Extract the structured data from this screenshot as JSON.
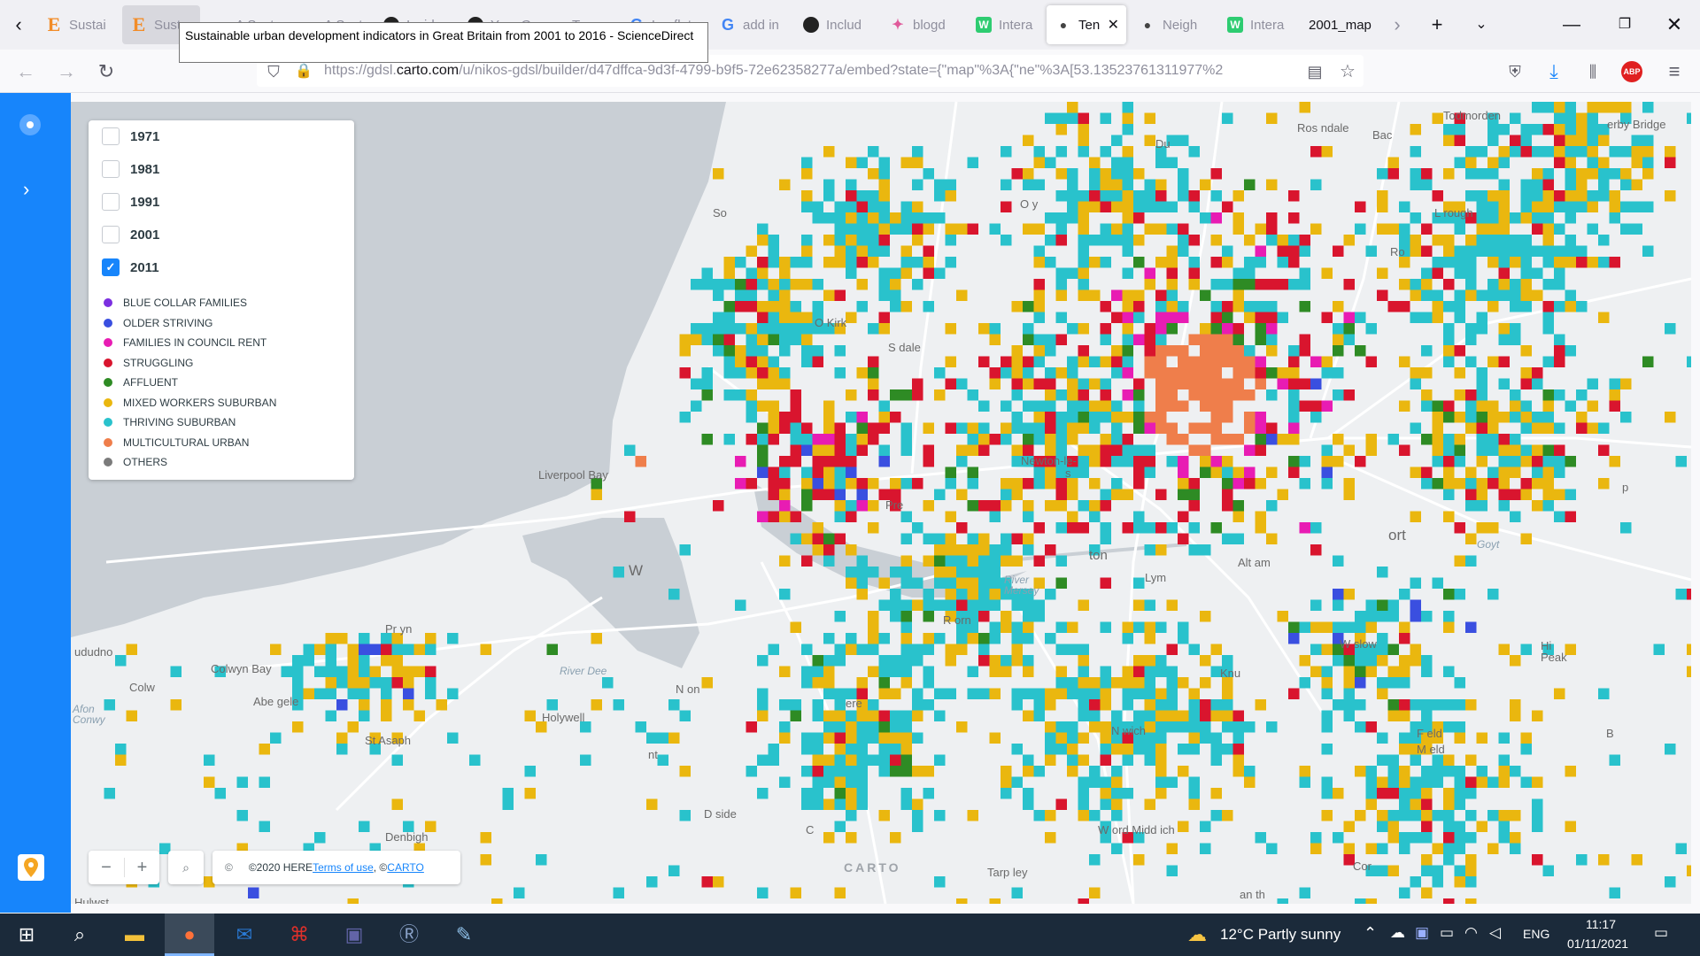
{
  "tabs": [
    {
      "label": "Sustai",
      "favicon": "e-icon",
      "state": "inactive"
    },
    {
      "label": "Susta",
      "favicon": "e-icon",
      "state": "hovered"
    },
    {
      "label": "A Sust",
      "favicon": "doc-icon",
      "state": "inactive"
    },
    {
      "label": "A Sust",
      "favicon": "doc-icon",
      "state": "inactive"
    },
    {
      "label": "Inside",
      "favicon": "github-icon",
      "state": "inactive"
    },
    {
      "label": "Your G",
      "favicon": "github-icon",
      "state": "inactive"
    },
    {
      "label": "Ten",
      "favicon": "dot-icon",
      "state": "inactive"
    },
    {
      "label": "Leaflet",
      "favicon": "g-icon",
      "state": "inactive"
    },
    {
      "label": "add in",
      "favicon": "google-icon",
      "state": "inactive"
    },
    {
      "label": "Includ",
      "favicon": "github-icon",
      "state": "inactive"
    },
    {
      "label": "blogd",
      "favicon": "blog-icon",
      "state": "inactive"
    },
    {
      "label": "Intera",
      "favicon": "w-icon",
      "state": "inactive"
    },
    {
      "label": "Ten",
      "favicon": "dot-icon",
      "state": "active"
    },
    {
      "label": "Neigh",
      "favicon": "dot-icon",
      "state": "inactive"
    },
    {
      "label": "Intera",
      "favicon": "w-icon",
      "state": "inactive"
    },
    {
      "label": "2001_map",
      "favicon": "",
      "state": "plain"
    }
  ],
  "tooltip": "Sustainable urban development indicators in Great Britain from 2001 to 2016 - ScienceDirect",
  "url": {
    "prefix": "https://gdsl.",
    "domain": "carto.com",
    "rest": "/u/nikos-gdsl/builder/d47dffca-9d3f-4799-b9f5-72e62358277a/embed?state={\"map\"%3A{\"ne\"%3A[53.13523761311977%2"
  },
  "legend": {
    "years": [
      {
        "label": "1971",
        "checked": false
      },
      {
        "label": "1981",
        "checked": false
      },
      {
        "label": "1991",
        "checked": false
      },
      {
        "label": "2001",
        "checked": false
      },
      {
        "label": "2011",
        "checked": true
      }
    ],
    "categories": [
      {
        "label": "BLUE COLLAR FAMILIES",
        "color": "#7b2fe0"
      },
      {
        "label": "OLDER STRIVING",
        "color": "#3a4fe0"
      },
      {
        "label": "FAMILIES IN COUNCIL RENT",
        "color": "#e81cb3"
      },
      {
        "label": "STRUGGLING",
        "color": "#d9152e"
      },
      {
        "label": "AFFLUENT",
        "color": "#2e8b24"
      },
      {
        "label": "MIXED WORKERS SUBURBAN",
        "color": "#eab70f"
      },
      {
        "label": "THRIVING SUBURBAN",
        "color": "#29c2cc"
      },
      {
        "label": "MULTICULTURAL URBAN",
        "color": "#ef7e4b"
      },
      {
        "label": "OTHERS",
        "color": "#7b7b7b"
      }
    ]
  },
  "map": {
    "places": [
      "Todmorden",
      "Ros  ndale",
      "Bac",
      "erby Bridge",
      "Du",
      "O   y",
      "L    rough",
      "Ro",
      "So",
      "O   Kirk",
      "S      dale",
      "Newton-le-",
      "s",
      "Liverpool Bay",
      "Pre",
      "W",
      "Alt      am",
      "ort",
      "p",
      "Goyt",
      "ton",
      "Lym",
      "R     orn",
      "W       slow",
      "Hi Peak",
      "Knu",
      "Pr    yn",
      "Colwyn Bay",
      "Colw",
      "Abe   gele",
      "St Asaph",
      "Holywell",
      "N   on",
      "ere",
      "N    wich",
      "F    eld",
      "B",
      "M   eld",
      "D   side",
      "C",
      "Denbigh",
      "W         ord  Midd     ich",
      "Tarp   ley",
      "Cor",
      "an     th",
      "nt",
      "Hulwst",
      "ududno"
    ],
    "waters": [
      "River Dee",
      "River Mersey",
      "Afon Conwy"
    ]
  },
  "attribution": {
    "prefix": "©",
    "here": "©2020 HERE ",
    "terms": "Terms of use",
    "sep": ", © ",
    "carto": "CARTO"
  },
  "watermark": "CARTO",
  "taskbar": {
    "weather": "12°C  Partly sunny",
    "lang": "ENG",
    "time": "11:17",
    "date": "01/11/2021"
  }
}
